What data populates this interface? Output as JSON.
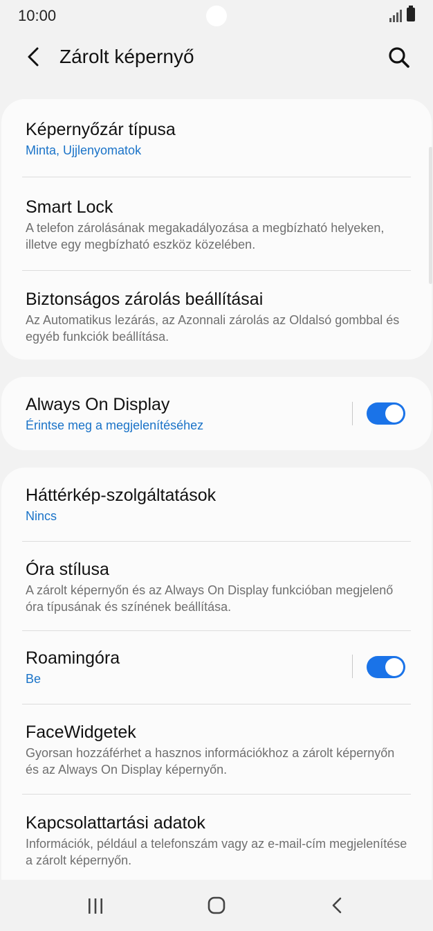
{
  "status_bar": {
    "time": "10:00"
  },
  "app_bar": {
    "title": "Zárolt képernyő",
    "back_icon": "back-arrow-icon",
    "search_icon": "search-icon"
  },
  "cards": [
    {
      "items": [
        {
          "title": "Képernyőzár típusa",
          "subtitle": "Minta, Ujjlenyomatok",
          "subtitle_style": "blue"
        },
        {
          "title": "Smart Lock",
          "subtitle": "A telefon zárolásának megakadályozása a megbízható helyeken, illetve egy megbízható eszköz közelében.",
          "subtitle_style": "gray"
        },
        {
          "title": "Biztonságos zárolás beállításai",
          "subtitle": "Az Automatikus lezárás, az Azonnali zárolás az Oldalsó gombbal és egyéb funkciók beállítása.",
          "subtitle_style": "gray"
        }
      ]
    },
    {
      "items": [
        {
          "title": "Always On Display",
          "subtitle": "Érintse meg a megjelenítéséhez",
          "subtitle_style": "blue",
          "toggle": true
        }
      ]
    },
    {
      "items": [
        {
          "title": "Háttérkép-szolgáltatások",
          "subtitle": "Nincs",
          "subtitle_style": "blue"
        },
        {
          "title": "Óra stílusa",
          "subtitle": "A zárolt képernyőn és az Always On Display funkcióban megjelenő óra típusának és színének beállítása.",
          "subtitle_style": "gray"
        },
        {
          "title": "Roamingóra",
          "subtitle": "Be",
          "subtitle_style": "blue",
          "toggle": true
        },
        {
          "title": "FaceWidgetek",
          "subtitle": "Gyorsan hozzáférhet a hasznos információkhoz a zárolt képernyőn és az Always On Display képernyőn.",
          "subtitle_style": "gray"
        },
        {
          "title": "Kapcsolattartási adatok",
          "subtitle": "Információk, például a telefonszám vagy az e-mail-cím megjelenítése a zárolt képernyőn.",
          "subtitle_style": "gray"
        }
      ]
    }
  ],
  "colors": {
    "accent": "#1a73e8",
    "link_text": "#1a73c8",
    "background": "#f2f2f2",
    "card": "#fbfbfb"
  },
  "nav_bar": {
    "recents_icon": "recents-icon",
    "home_icon": "home-icon",
    "back_icon": "back-icon"
  }
}
